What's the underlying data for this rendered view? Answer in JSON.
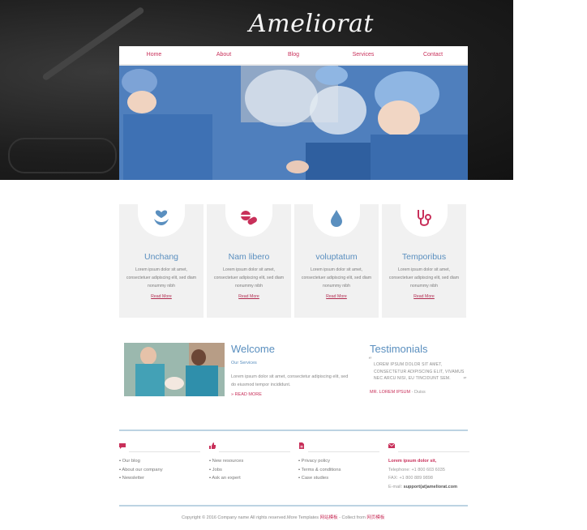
{
  "brand": {
    "logo": "Ameliorat"
  },
  "nav": {
    "items": [
      "Home",
      "About",
      "Blog",
      "Services",
      "Contact"
    ]
  },
  "services": [
    {
      "icon": "hands-heart-icon",
      "title": "Unchang",
      "text": "Lorem ipsum dolor sit amet, consectetuer adipiscing elit, sed diam nonummy nibh",
      "link": "Read More"
    },
    {
      "icon": "pills-icon",
      "title": "Nam libero",
      "text": "Lorem ipsum dolor sit amet, consectetuer adipiscing elit, sed diam nonummy nibh",
      "link": "Read More"
    },
    {
      "icon": "drop-icon",
      "title": "voluptatum",
      "text": "Lorem ipsum dolor sit amet, consectetuer adipiscing elit, sed diam nonummy nibh",
      "link": "Read More"
    },
    {
      "icon": "stethoscope-icon",
      "title": "Temporibus",
      "text": "Lorem ipsum dolor sit amet, consectetuer adipiscing elit, sed diam nonummy nibh",
      "link": "Read More"
    }
  ],
  "welcome": {
    "title": "Welcome",
    "subtitle": "Our Services",
    "body": "Lorem ipsum dolor sit amet, consectetur adipiscing elit, sed do eiusmod tempor incididunt.",
    "more": "» READ MORE"
  },
  "testimonials": {
    "title": "Testimonials",
    "quote": "LOREM IPSUM DOLOR SIT AMET, CONSECTETUR ADIPISCING ELIT, VIVAMUS NEC ARCU NISI, EU TINCIDUNT SEM.",
    "author": "MR. LOREM IPSUM",
    "role": "- Duiss"
  },
  "footer": {
    "col1": {
      "icon": "speech-bubble-icon",
      "items": [
        "Our blog",
        "About our company",
        "Newsletter"
      ]
    },
    "col2": {
      "icon": "thumbs-up-icon",
      "items": [
        "New resources",
        "Jobs",
        "Ask an expert"
      ]
    },
    "col3": {
      "icon": "document-icon",
      "items": [
        "Privacy policy",
        "Terms & conditions",
        "Case studies"
      ]
    },
    "col4": {
      "icon": "envelope-icon",
      "name": "Lorem ipsum dolor sit,",
      "phone": "Telephone: +1 800 603 6035",
      "fax": "FAX: +1 800 889 9898",
      "email_label": "E-mail: ",
      "email": "support(at)ameliorat.com"
    },
    "copyright": "Copyright © 2016 Company name All rights reserved.More Templates",
    "copyright_link1": "网站模板",
    "copyright_mid": " - Collect from",
    "copyright_link2": "网页模板"
  },
  "colors": {
    "accent_red": "#c8305a",
    "accent_blue": "#5a8fbf",
    "box_gray": "#f1f1f1",
    "rule_blue": "#bcd3e2"
  }
}
